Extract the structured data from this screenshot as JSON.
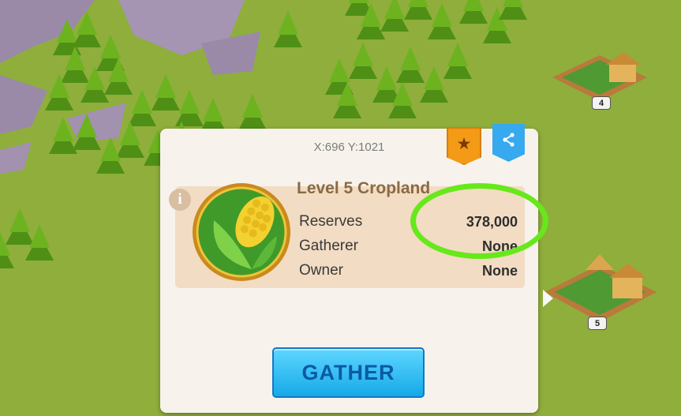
{
  "colors": {
    "grass": "#8fae3c",
    "tree": "#5fa21a",
    "panel": "#f7f3ec",
    "info_panel": "#f2dcc3",
    "favorite_banner": "#f39a16",
    "share_banner": "#36a9ef",
    "gather_button": "#1aa9e8",
    "highlight_ring": "#67e81b"
  },
  "popup": {
    "coordinates": "X:696 Y:1021",
    "favorite_icon": "star-icon",
    "share_icon": "share-icon",
    "info_icon": "info-icon",
    "resource_icon": "corn-icon",
    "title": "Level 5 Cropland",
    "rows": [
      {
        "label": "Reserves",
        "value": "378,000"
      },
      {
        "label": "Gatherer",
        "value": "None"
      },
      {
        "label": "Owner",
        "value": "None"
      }
    ],
    "gather_label": "GATHER"
  },
  "map": {
    "farms": [
      {
        "level": "4"
      },
      {
        "level": "5"
      }
    ]
  }
}
